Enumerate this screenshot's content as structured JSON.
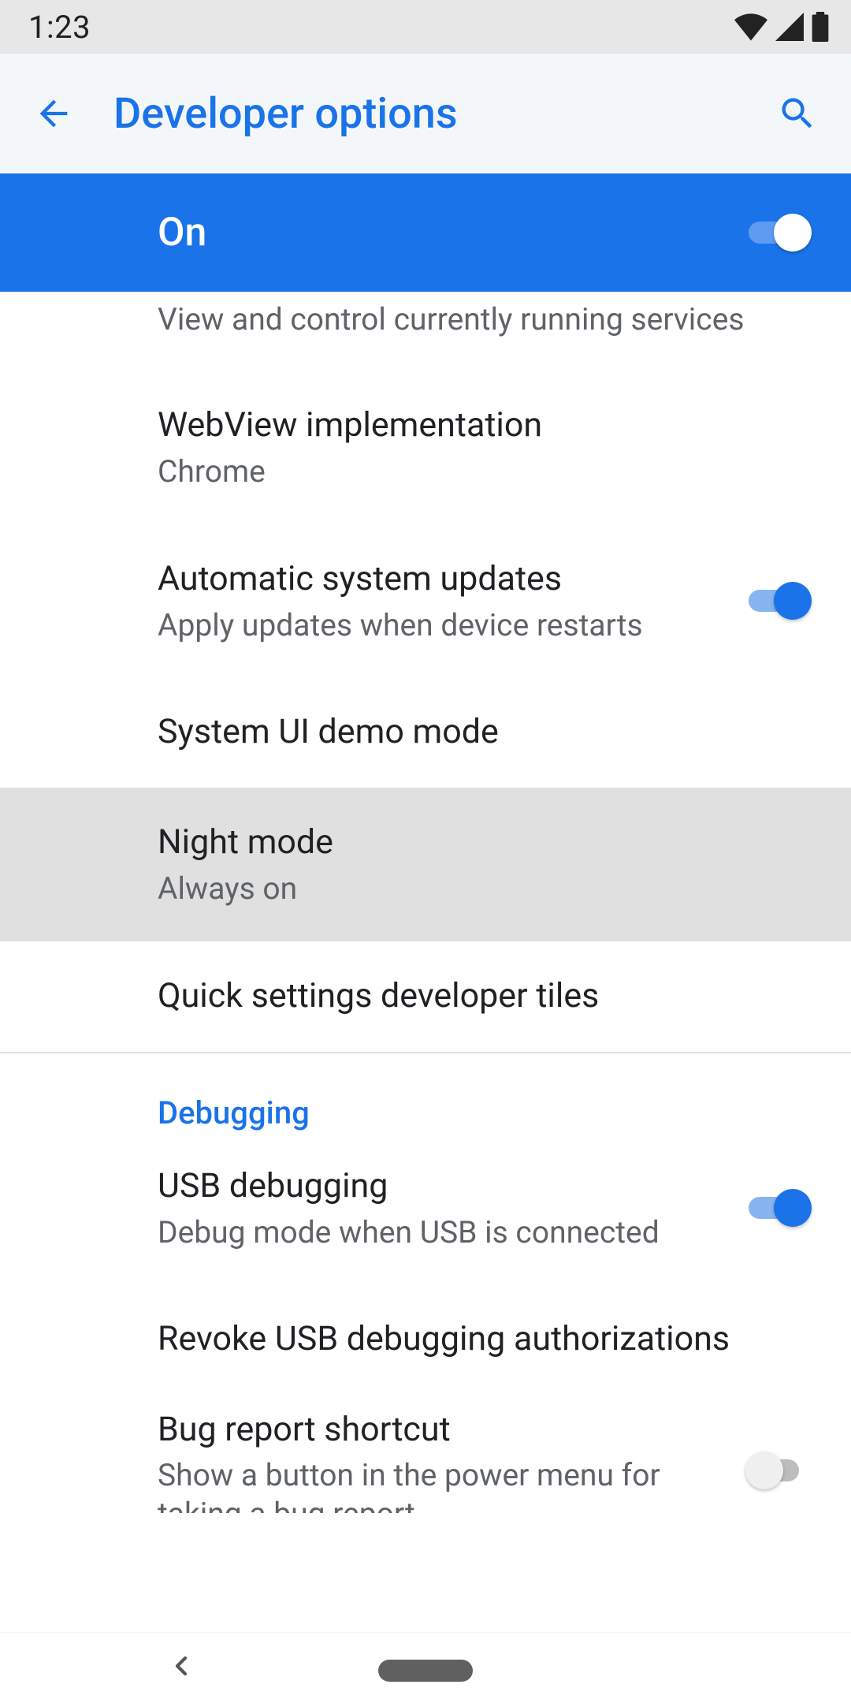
{
  "statusbar": {
    "time": "1:23"
  },
  "appbar": {
    "title": "Developer options"
  },
  "master_toggle": {
    "label": "On",
    "state": "on"
  },
  "items": [
    {
      "sub": "View and control currently running services"
    },
    {
      "title": "WebView implementation",
      "sub": "Chrome"
    },
    {
      "title": "Automatic system updates",
      "sub": "Apply updates when device restarts",
      "switch": "on"
    },
    {
      "title": "System UI demo mode"
    },
    {
      "title": "Night mode",
      "sub": "Always on"
    },
    {
      "title": "Quick settings developer tiles"
    }
  ],
  "section": {
    "header": "Debugging"
  },
  "debug_items": [
    {
      "title": "USB debugging",
      "sub": "Debug mode when USB is connected",
      "switch": "on"
    },
    {
      "title": "Revoke USB debugging authorizations"
    },
    {
      "title": "Bug report shortcut",
      "sub": "Show a button in the power menu for taking a bug report",
      "switch": "off"
    }
  ]
}
